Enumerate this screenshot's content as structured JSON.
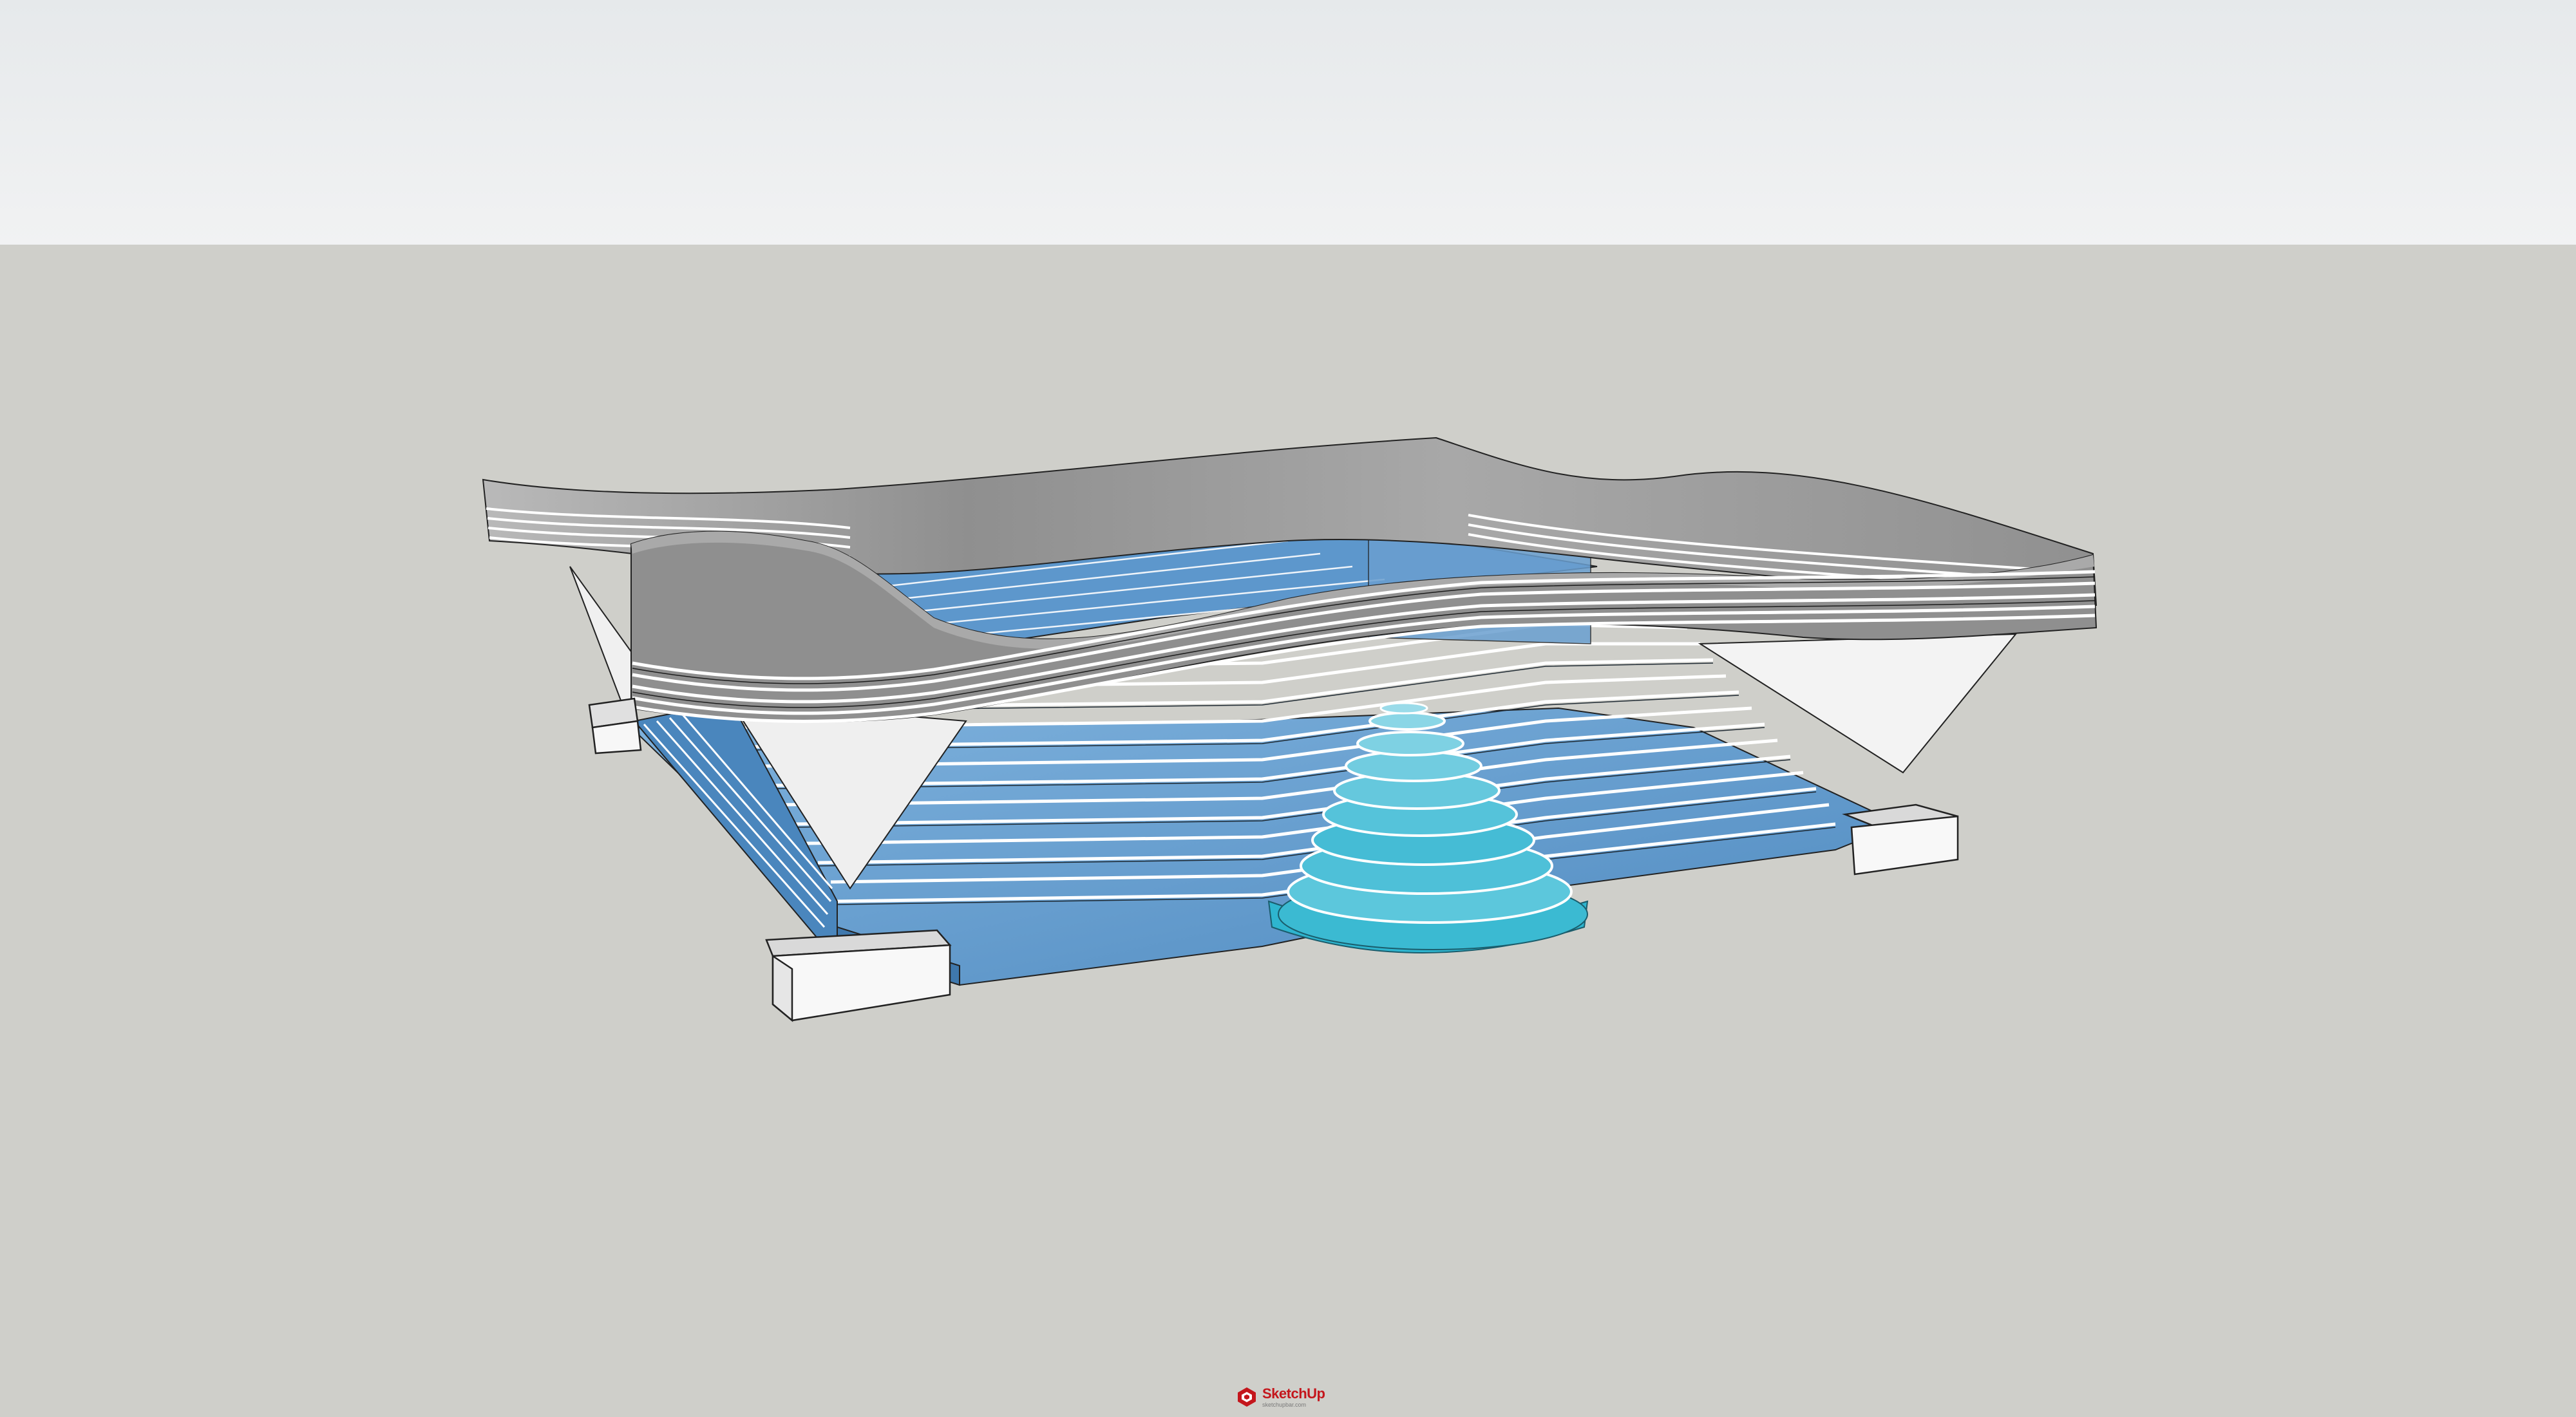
{
  "app": {
    "name": "SketchUp"
  },
  "scene": {
    "sky_color_top": "#e9ecee",
    "sky_color_bottom": "#f0f1f2",
    "ground_color": "#cfcfca",
    "roof_color": "#9a9a9a",
    "roof_light_color": "#d8d8d8",
    "glass_color": "#5b95c9",
    "glass_light_color": "#8fc0e4",
    "fountain_color": "#3ec0d6",
    "wall_color": "#f1f1f1"
  },
  "watermark": {
    "brand": "SketchUp",
    "sub": "sketchupbar.com",
    "icon": "sketchup-logo-icon"
  }
}
